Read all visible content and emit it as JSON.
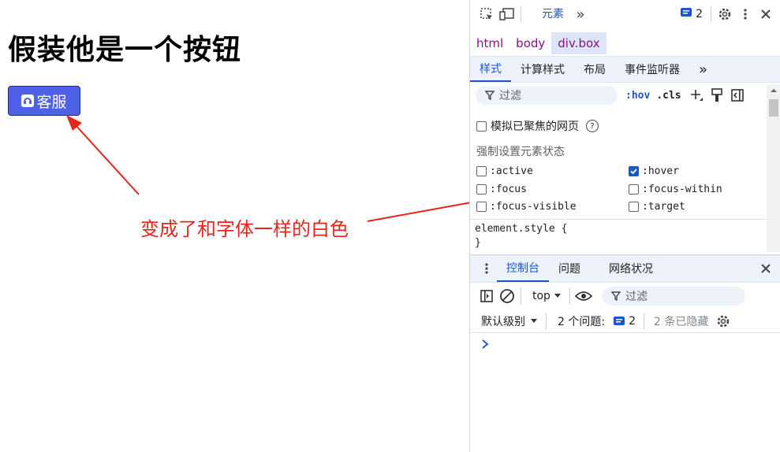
{
  "page": {
    "title": "假装他是一个按钮",
    "button_label": "客服",
    "annotation": "变成了和字体一样的白色"
  },
  "devtools": {
    "toolbar": {
      "tab_elements": "元素",
      "more_tabs": "»",
      "issues_count": "2"
    },
    "breadcrumb": [
      "html",
      "body",
      "div.box"
    ],
    "subtabs": {
      "styles": "样式",
      "computed": "计算样式",
      "layout": "布局",
      "listeners": "事件监听器",
      "more": "»"
    },
    "filter": {
      "placeholder": "过滤",
      "hov": ":hov",
      "cls": ".cls"
    },
    "emulate_focus": "模拟已聚焦的网页",
    "force_state_label": "强制设置元素状态",
    "states": {
      "active": ":active",
      "hover": ":hover",
      "focus": ":focus",
      "focus_within": ":focus-within",
      "focus_visible": ":focus-visible",
      "target": ":target"
    },
    "rule": {
      "selector": "element.style {",
      "close": "}"
    },
    "drawer": {
      "console": "控制台",
      "issues": "问题",
      "network": "网络状况"
    },
    "console": {
      "context": "top",
      "filter_placeholder": "过滤",
      "level": "默认级别",
      "issues_label": "2 个问题:",
      "issues_count": "2",
      "hidden": "2 条已隐藏"
    }
  },
  "colors": {
    "button_bg": "#4f61e6",
    "annotation": "#e6251b",
    "accent": "#1a56c7"
  }
}
